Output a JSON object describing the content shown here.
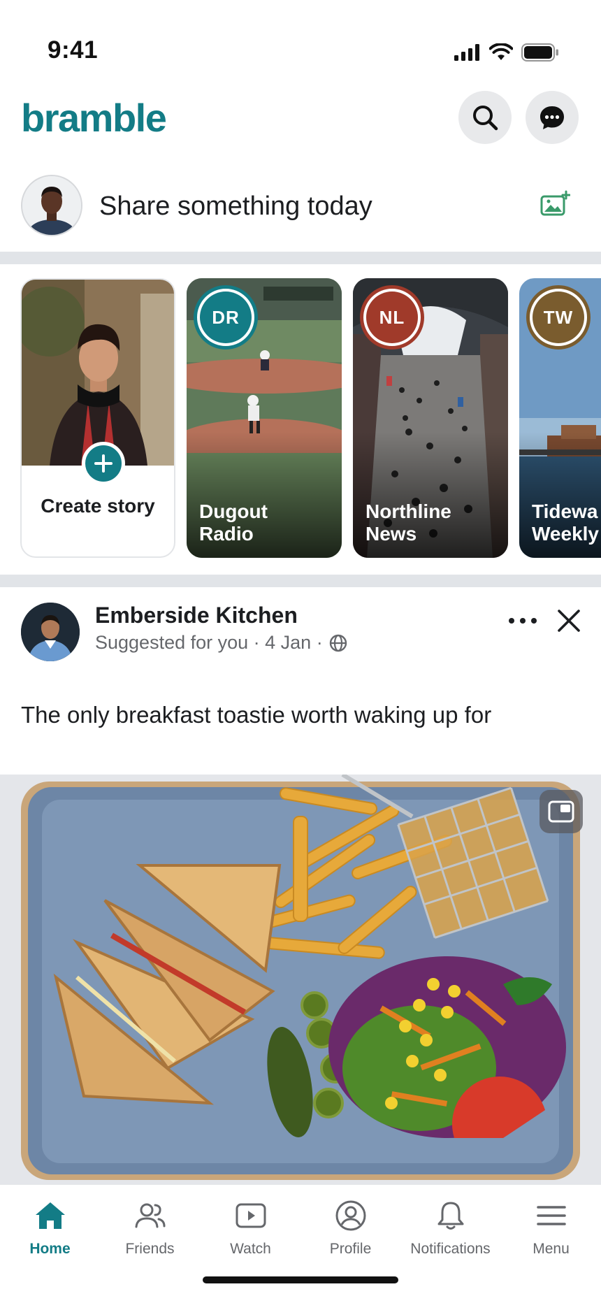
{
  "status_bar": {
    "time": "9:41"
  },
  "header": {
    "app_name": "bramble",
    "brand_color": "#137c86"
  },
  "composer": {
    "placeholder": "Share something today"
  },
  "stories": {
    "create": {
      "label": "Create story"
    },
    "items": [
      {
        "initials": "DR",
        "name": "Dugout\nRadio",
        "ring_color": "#137c86"
      },
      {
        "initials": "NL",
        "name": "Northline\nNews",
        "ring_color": "#a03a2a"
      },
      {
        "initials": "TW",
        "name": "Tidewa\nWeekly",
        "ring_color": "#7a5c2e"
      }
    ]
  },
  "post": {
    "author": "Emberside Kitchen",
    "meta": "Suggested for you · 4 Jan ·",
    "text": "The only breakfast toastie worth waking up for"
  },
  "tabbar": {
    "tabs": [
      {
        "label": "Home",
        "icon": "home-icon",
        "active": true
      },
      {
        "label": "Friends",
        "icon": "friends-icon",
        "active": false
      },
      {
        "label": "Watch",
        "icon": "watch-icon",
        "active": false
      },
      {
        "label": "Profile",
        "icon": "profile-icon",
        "active": false
      },
      {
        "label": "Notifications",
        "icon": "bell-icon",
        "active": false
      },
      {
        "label": "Menu",
        "icon": "menu-icon",
        "active": false
      }
    ]
  }
}
